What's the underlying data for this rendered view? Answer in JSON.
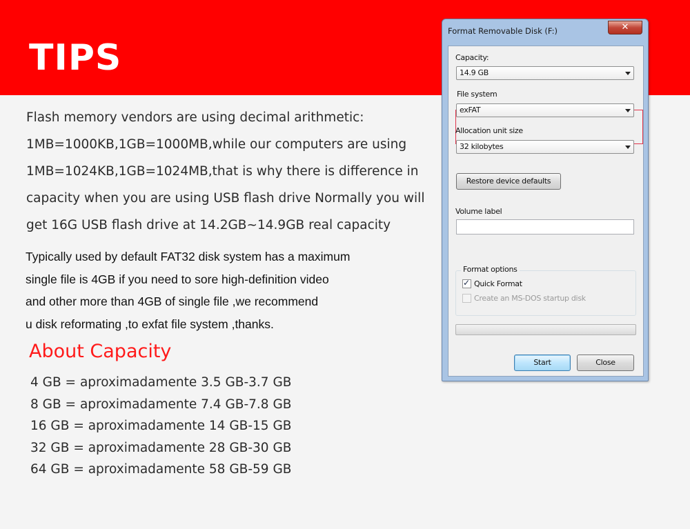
{
  "banner": {
    "title": "TIPS",
    "color": "#ff0000"
  },
  "intro_lines": [
    "Flash memory vendors are using decimal arithmetic:",
    "1MB=1000KB,1GB=1000MB,while our computers are using",
    "1MB=1024KB,1GB=1024MB,that is why there is difference in",
    "capacity when you are using USB flash drive Normally you will",
    "get 16G USB flash drive at 14.2GB~14.9GB real capacity"
  ],
  "fat32_lines": [
    "Typically used  by default FAT32 disk system  has a maximum",
    " single file is 4GB if you need to sore high-definition  video",
    " and other more than 4GB of single file ,we recommend",
    " u  disk  reformating ,to exfat file system ,thanks."
  ],
  "about": {
    "title": "About Capacity",
    "title_color": "#ff1a1a",
    "items": [
      "4 GB = aproximadamente 3.5 GB-3.7 GB",
      "8 GB = aproximadamente 7.4 GB-7.8 GB",
      "16 GB = aproximadamente 14 GB-15 GB",
      "32 GB = aproximadamente 28 GB-30 GB",
      "64 GB = aproximadamente 58 GB-59 GB"
    ]
  },
  "dialog": {
    "title": "Format Removable Disk (F:)",
    "close_glyph": "✕",
    "capacity_label": "Capacity:",
    "capacity_value": "14.9 GB",
    "filesystem_label": "File system",
    "filesystem_value": "exFAT",
    "allocation_label": "Allocation unit size",
    "allocation_value": "32 kilobytes",
    "restore_button": "Restore device defaults",
    "volume_label": "Volume label",
    "volume_value": "",
    "format_options_label": "Format options",
    "quick_format_label": "Quick Format",
    "quick_format_checked": true,
    "msdos_label": "Create an MS-DOS startup disk",
    "msdos_checked": false,
    "progress_fraction": 0,
    "start_button": "Start",
    "close_button": "Close",
    "highlight_color": "#e0334a"
  }
}
